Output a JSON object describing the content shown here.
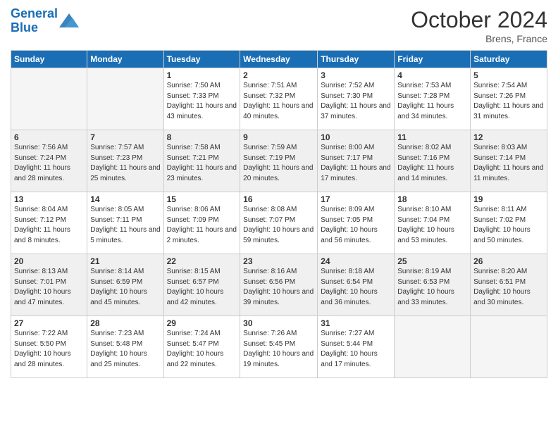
{
  "logo": {
    "line1": "General",
    "line2": "Blue"
  },
  "title": "October 2024",
  "location": "Brens, France",
  "days_of_week": [
    "Sunday",
    "Monday",
    "Tuesday",
    "Wednesday",
    "Thursday",
    "Friday",
    "Saturday"
  ],
  "weeks": [
    [
      {
        "num": "",
        "info": ""
      },
      {
        "num": "",
        "info": ""
      },
      {
        "num": "1",
        "info": "Sunrise: 7:50 AM\nSunset: 7:33 PM\nDaylight: 11 hours and 43 minutes."
      },
      {
        "num": "2",
        "info": "Sunrise: 7:51 AM\nSunset: 7:32 PM\nDaylight: 11 hours and 40 minutes."
      },
      {
        "num": "3",
        "info": "Sunrise: 7:52 AM\nSunset: 7:30 PM\nDaylight: 11 hours and 37 minutes."
      },
      {
        "num": "4",
        "info": "Sunrise: 7:53 AM\nSunset: 7:28 PM\nDaylight: 11 hours and 34 minutes."
      },
      {
        "num": "5",
        "info": "Sunrise: 7:54 AM\nSunset: 7:26 PM\nDaylight: 11 hours and 31 minutes."
      }
    ],
    [
      {
        "num": "6",
        "info": "Sunrise: 7:56 AM\nSunset: 7:24 PM\nDaylight: 11 hours and 28 minutes."
      },
      {
        "num": "7",
        "info": "Sunrise: 7:57 AM\nSunset: 7:23 PM\nDaylight: 11 hours and 25 minutes."
      },
      {
        "num": "8",
        "info": "Sunrise: 7:58 AM\nSunset: 7:21 PM\nDaylight: 11 hours and 23 minutes."
      },
      {
        "num": "9",
        "info": "Sunrise: 7:59 AM\nSunset: 7:19 PM\nDaylight: 11 hours and 20 minutes."
      },
      {
        "num": "10",
        "info": "Sunrise: 8:00 AM\nSunset: 7:17 PM\nDaylight: 11 hours and 17 minutes."
      },
      {
        "num": "11",
        "info": "Sunrise: 8:02 AM\nSunset: 7:16 PM\nDaylight: 11 hours and 14 minutes."
      },
      {
        "num": "12",
        "info": "Sunrise: 8:03 AM\nSunset: 7:14 PM\nDaylight: 11 hours and 11 minutes."
      }
    ],
    [
      {
        "num": "13",
        "info": "Sunrise: 8:04 AM\nSunset: 7:12 PM\nDaylight: 11 hours and 8 minutes."
      },
      {
        "num": "14",
        "info": "Sunrise: 8:05 AM\nSunset: 7:11 PM\nDaylight: 11 hours and 5 minutes."
      },
      {
        "num": "15",
        "info": "Sunrise: 8:06 AM\nSunset: 7:09 PM\nDaylight: 11 hours and 2 minutes."
      },
      {
        "num": "16",
        "info": "Sunrise: 8:08 AM\nSunset: 7:07 PM\nDaylight: 10 hours and 59 minutes."
      },
      {
        "num": "17",
        "info": "Sunrise: 8:09 AM\nSunset: 7:05 PM\nDaylight: 10 hours and 56 minutes."
      },
      {
        "num": "18",
        "info": "Sunrise: 8:10 AM\nSunset: 7:04 PM\nDaylight: 10 hours and 53 minutes."
      },
      {
        "num": "19",
        "info": "Sunrise: 8:11 AM\nSunset: 7:02 PM\nDaylight: 10 hours and 50 minutes."
      }
    ],
    [
      {
        "num": "20",
        "info": "Sunrise: 8:13 AM\nSunset: 7:01 PM\nDaylight: 10 hours and 47 minutes."
      },
      {
        "num": "21",
        "info": "Sunrise: 8:14 AM\nSunset: 6:59 PM\nDaylight: 10 hours and 45 minutes."
      },
      {
        "num": "22",
        "info": "Sunrise: 8:15 AM\nSunset: 6:57 PM\nDaylight: 10 hours and 42 minutes."
      },
      {
        "num": "23",
        "info": "Sunrise: 8:16 AM\nSunset: 6:56 PM\nDaylight: 10 hours and 39 minutes."
      },
      {
        "num": "24",
        "info": "Sunrise: 8:18 AM\nSunset: 6:54 PM\nDaylight: 10 hours and 36 minutes."
      },
      {
        "num": "25",
        "info": "Sunrise: 8:19 AM\nSunset: 6:53 PM\nDaylight: 10 hours and 33 minutes."
      },
      {
        "num": "26",
        "info": "Sunrise: 8:20 AM\nSunset: 6:51 PM\nDaylight: 10 hours and 30 minutes."
      }
    ],
    [
      {
        "num": "27",
        "info": "Sunrise: 7:22 AM\nSunset: 5:50 PM\nDaylight: 10 hours and 28 minutes."
      },
      {
        "num": "28",
        "info": "Sunrise: 7:23 AM\nSunset: 5:48 PM\nDaylight: 10 hours and 25 minutes."
      },
      {
        "num": "29",
        "info": "Sunrise: 7:24 AM\nSunset: 5:47 PM\nDaylight: 10 hours and 22 minutes."
      },
      {
        "num": "30",
        "info": "Sunrise: 7:26 AM\nSunset: 5:45 PM\nDaylight: 10 hours and 19 minutes."
      },
      {
        "num": "31",
        "info": "Sunrise: 7:27 AM\nSunset: 5:44 PM\nDaylight: 10 hours and 17 minutes."
      },
      {
        "num": "",
        "info": ""
      },
      {
        "num": "",
        "info": ""
      }
    ]
  ]
}
